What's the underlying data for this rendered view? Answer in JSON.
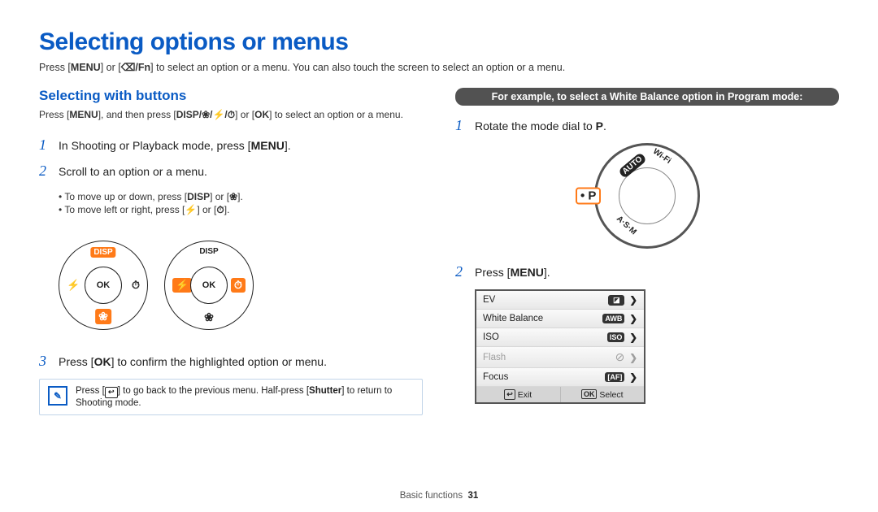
{
  "title": "Selecting options or menus",
  "intro_a": "Press [",
  "intro_menu": "MENU",
  "intro_b": "] or [",
  "intro_fn": "⌫/Fn",
  "intro_c": "] to select an option or a menu. You can also touch the screen to select an option or a menu.",
  "left": {
    "heading": "Selecting with buttons",
    "sub_a": "Press [",
    "sub_menu": "MENU",
    "sub_b": "], and then press [",
    "sub_btns": "DISP/❀/⚡/⏱",
    "sub_c": "] or [",
    "sub_ok": "OK",
    "sub_d": "] to select an option or a menu.",
    "steps": {
      "s1_num": "1",
      "s1_a": "In Shooting or Playback mode, press [",
      "s1_menu": "MENU",
      "s1_b": "].",
      "s2_num": "2",
      "s2": "Scroll to an option or a menu.",
      "s2_bullet1_a": "To move up or down, press [",
      "s2_bullet1_disp": "DISP",
      "s2_bullet1_b": "] or [",
      "s2_bullet1_flower": "❀",
      "s2_bullet1_c": "].",
      "s2_bullet2_a": "To move left or right, press [",
      "s2_bullet2_flash": "⚡",
      "s2_bullet2_b": "] or [",
      "s2_bullet2_timer": "⏱",
      "s2_bullet2_c": "].",
      "s3_num": "3",
      "s3_a": "Press [",
      "s3_ok": "OK",
      "s3_b": "] to confirm the highlighted option or menu."
    },
    "wheel": {
      "top": "DISP",
      "bottom": "❀",
      "left": "⚡",
      "right": "⏱",
      "ok": "OK"
    },
    "note_a": "Press [",
    "note_back": "↩",
    "note_b": "] to go back to the previous menu. Half-press [",
    "note_shutter": "Shutter",
    "note_c": "] to return to Shooting mode."
  },
  "right": {
    "example_bar": "For example, to select a White Balance option in Program mode:",
    "s1_num": "1",
    "s1_a": "Rotate the mode dial to ",
    "s1_mode": "P",
    "s1_b": ".",
    "modedial": {
      "p": "P",
      "auto": "AUTO",
      "wifi": "Wi-Fi",
      "asm": "A·S·M"
    },
    "s2_num": "2",
    "s2_a": "Press [",
    "s2_menu": "MENU",
    "s2_b": "].",
    "menu": {
      "items": [
        {
          "label": "EV",
          "icon": "◪",
          "disabled": false
        },
        {
          "label": "White Balance",
          "icon": "AWB",
          "disabled": false
        },
        {
          "label": "ISO",
          "icon": "ISO",
          "disabled": false
        },
        {
          "label": "Flash",
          "icon": "⊘",
          "disabled": true
        },
        {
          "label": "Focus",
          "icon": "[AF]",
          "disabled": false
        }
      ],
      "footer_exit_icon": "↩",
      "footer_exit": "Exit",
      "footer_select_icon": "OK",
      "footer_select": "Select"
    }
  },
  "footer": {
    "section": "Basic functions",
    "page": "31"
  }
}
